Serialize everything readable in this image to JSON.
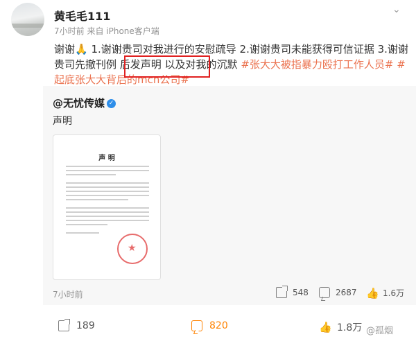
{
  "post": {
    "username": "黄毛毛111",
    "time": "7小时前",
    "source": "来自 iPhone客户端",
    "text_part1": "谢谢🙏 1.谢谢贵司对我进行的安慰疏导 2.谢谢贵司未能获得可信证据 3.谢谢贵司先撤刊例 后发声明 以及对我的沉默 ",
    "tag1": "#张大大被指暴力殴打工作人员#",
    "tag2": "#起底张大大背后的mcn公司#"
  },
  "repost": {
    "username": "@无忧传媒",
    "text": "声明",
    "doc_title": "声  明",
    "time": "7小时前",
    "shares": "548",
    "comments": "2687",
    "likes": "1.6万"
  },
  "footer": {
    "shares": "189",
    "comments": "820",
    "likes": "1.8万"
  },
  "watermark": "@孤烟",
  "colors": {
    "accent": "#ff8200",
    "tag": "#eb7350",
    "highlight": "#e02020",
    "verified": "#2e8ee9"
  }
}
